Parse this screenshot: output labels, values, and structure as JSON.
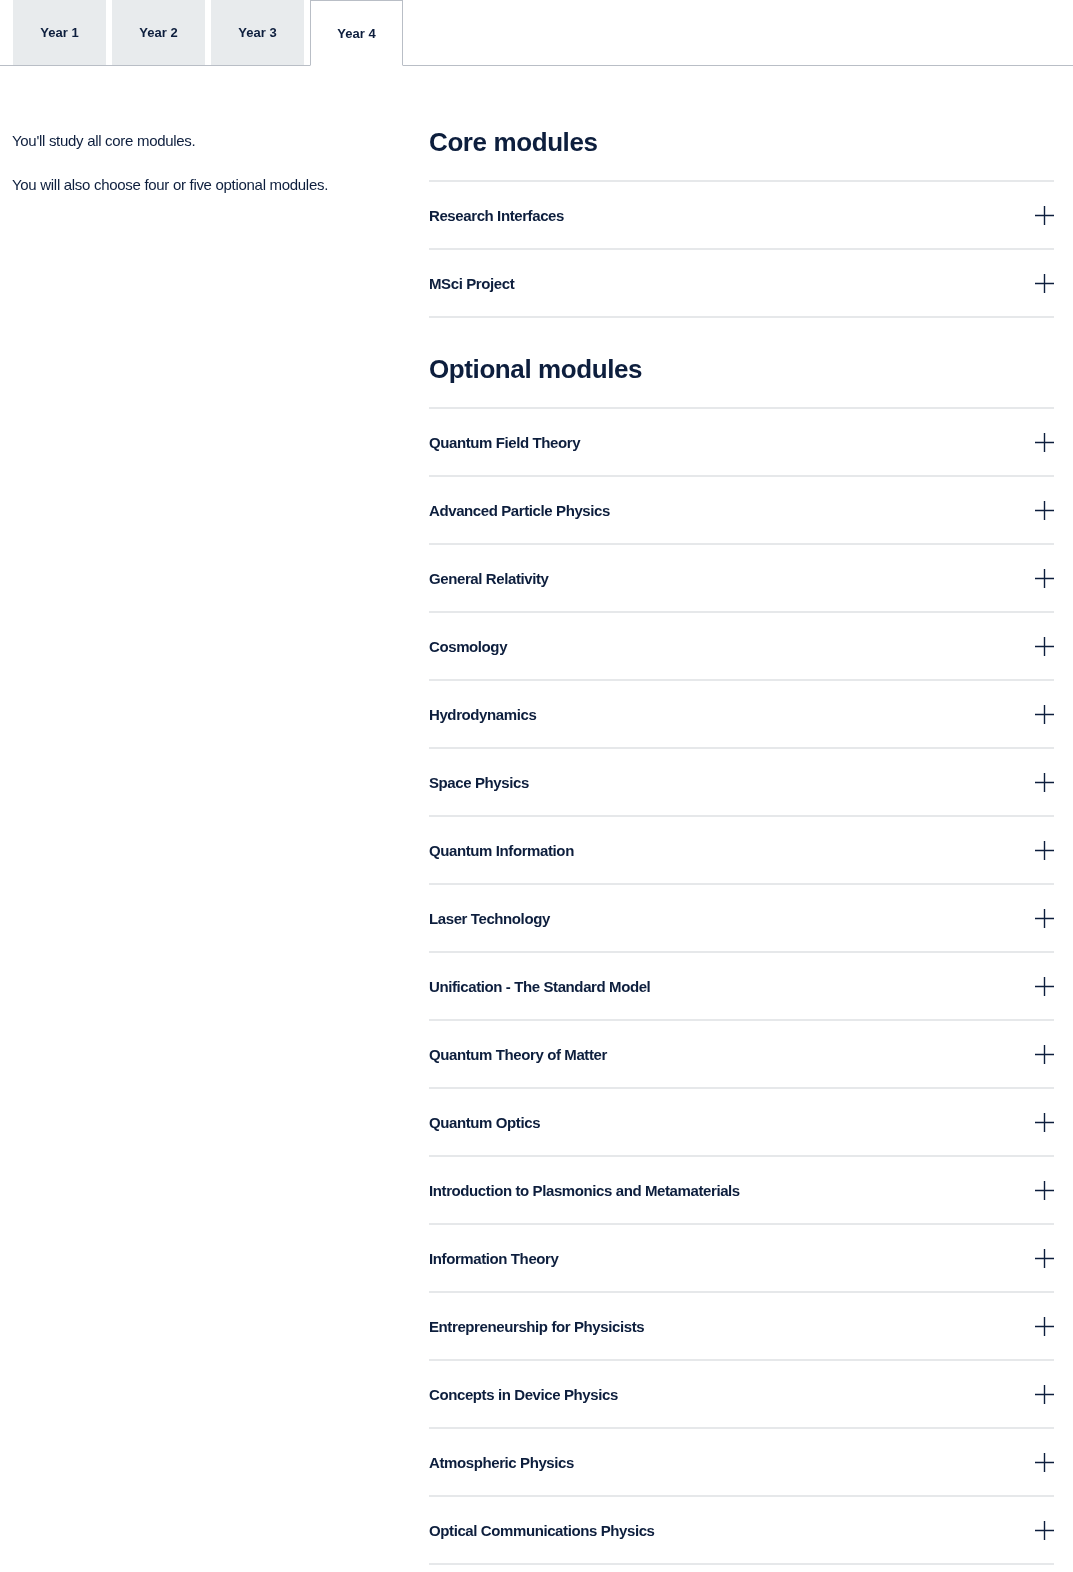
{
  "tabs": [
    {
      "label": "Year 1",
      "selected": false
    },
    {
      "label": "Year 2",
      "selected": false
    },
    {
      "label": "Year 3",
      "selected": false
    },
    {
      "label": "Year 4",
      "selected": true
    }
  ],
  "intro": [
    "You'll study all core modules.",
    "You will also choose four or five optional modules."
  ],
  "sections": [
    {
      "heading": "Core modules",
      "modules": [
        {
          "title": "Research Interfaces",
          "expanded": false
        },
        {
          "title": "MSci Project",
          "expanded": false
        }
      ]
    },
    {
      "heading": "Optional modules",
      "modules": [
        {
          "title": "Quantum Field Theory",
          "expanded": false
        },
        {
          "title": "Advanced Particle Physics",
          "expanded": false
        },
        {
          "title": "General Relativity",
          "expanded": false
        },
        {
          "title": "Cosmology",
          "expanded": false
        },
        {
          "title": "Hydrodynamics",
          "expanded": false
        },
        {
          "title": "Space Physics",
          "expanded": false
        },
        {
          "title": "Quantum Information",
          "expanded": false
        },
        {
          "title": "Laser Technology",
          "expanded": false
        },
        {
          "title": "Unification - The Standard Model",
          "expanded": false
        },
        {
          "title": "Quantum Theory of Matter",
          "expanded": false
        },
        {
          "title": "Quantum Optics",
          "expanded": false
        },
        {
          "title": "Introduction to Plasmonics and Metamaterials",
          "expanded": false
        },
        {
          "title": "Information Theory",
          "expanded": false
        },
        {
          "title": "Entrepreneurship for Physicists",
          "expanded": false
        },
        {
          "title": "Concepts in Device Physics",
          "expanded": false
        },
        {
          "title": "Atmospheric Physics",
          "expanded": false
        },
        {
          "title": "Optical Communications Physics",
          "expanded": false
        }
      ]
    }
  ]
}
